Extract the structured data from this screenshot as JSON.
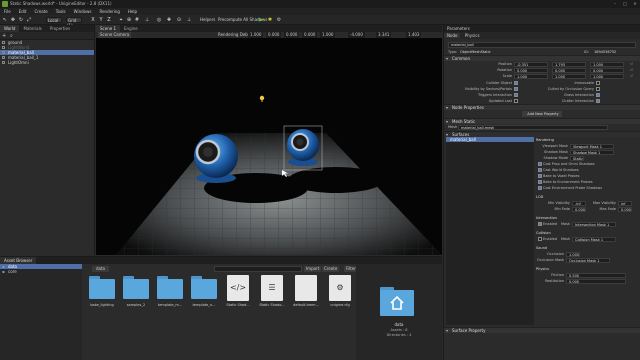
{
  "window": {
    "title": "Static Shadows.world* - UnigineEditor - 2.8 (DX11)",
    "minimize": "–",
    "maximize": "□",
    "close": "✕"
  },
  "menu": [
    "File",
    "Edit",
    "Create",
    "Tools",
    "Windows",
    "Rendering",
    "Help"
  ],
  "toolbar": {
    "space": "Local",
    "step": "Grid (1)",
    "helpers_label": "Helpers",
    "precompute_label": "Precompute All Shadows",
    "accent": "#5ac14a"
  },
  "world": {
    "tabs": [
      "World",
      "Materials",
      "Properties"
    ],
    "nodes": [
      {
        "name": "ground",
        "selected": false,
        "dim": false
      },
      {
        "name": "LightWorld",
        "selected": false,
        "dim": true
      },
      {
        "name": "material_ball",
        "selected": true,
        "dim": false
      },
      {
        "name": "material_ball_1",
        "selected": false,
        "dim": false
      },
      {
        "name": "LightOmni",
        "selected": false,
        "dim": false
      }
    ]
  },
  "scene": {
    "tabs": [
      "Scene 1",
      "Engine"
    ],
    "camera": "Scene Camera",
    "debug": "Rendering Debug",
    "values": [
      "1.000",
      "0.000",
      "0.000",
      "0.000",
      "1.000"
    ],
    "coords": [
      "-4.000",
      "3.341",
      "1.403"
    ]
  },
  "asset_browser": {
    "title": "Asset Browser",
    "tree": [
      "data",
      "core"
    ],
    "path": "data",
    "search_placeholder": "",
    "import_label": "Import",
    "create_label": "Create",
    "filter_label": "Filter",
    "items": [
      {
        "name": "bake_lighting",
        "kind": "folder"
      },
      {
        "name": "samples_2",
        "kind": "folder"
      },
      {
        "name": "template_m...",
        "kind": "folder"
      },
      {
        "name": "template_n...",
        "kind": "folder"
      },
      {
        "name": "Static Shad...",
        "kind": "file",
        "glyph": "</>"
      },
      {
        "name": "Static Shado...",
        "kind": "file",
        "glyph": "☰"
      },
      {
        "name": "default.bmm...",
        "kind": "file",
        "glyph": ""
      },
      {
        "name": "unigine.cfg",
        "kind": "file",
        "glyph": "⚙"
      }
    ],
    "preview": {
      "name": "data",
      "assets": "Assets : 8",
      "directories": "Directories : 4"
    }
  },
  "parameters": {
    "title": "Parameters",
    "tabs": [
      "Node",
      "Physics"
    ],
    "node_name": "material_ball",
    "type_label": "Type:",
    "type": "ObjectMeshStatic",
    "id_label": "ID:",
    "id": "1894536752",
    "common": {
      "title": "Common",
      "position_label": "Position",
      "position": [
        "-0.351",
        "1.793",
        "1.000"
      ],
      "rotation_label": "Rotation",
      "rotation": [
        "0.000",
        "0.000",
        "0.000"
      ],
      "scale_label": "Scale",
      "scale": [
        "1.000",
        "1.000",
        "1.000"
      ],
      "flags": [
        {
          "label": "Collider Object",
          "on": true
        },
        {
          "label": "Immovable",
          "on": false
        },
        {
          "label": "Visibility by Sectors/Portals",
          "on": true
        },
        {
          "label": "Culled by Occlusion Query",
          "on": false
        },
        {
          "label": "Triggers Interaction",
          "on": true
        },
        {
          "label": "Grass Interaction",
          "on": true
        },
        {
          "label": "Updated Last",
          "on": false
        },
        {
          "label": "Clutter Interaction",
          "on": true
        }
      ]
    },
    "node_props": {
      "title": "Node Properties",
      "add_label": "Add New Property"
    },
    "mesh_static": {
      "title": "Mesh Static",
      "mesh_label": "Mesh",
      "mesh": "material_ball.mesh",
      "surfaces_title": "Surfaces",
      "surface": "material_ball",
      "rendering_title": "Rendering",
      "viewport_mask_label": "Viewport Mask",
      "viewport_mask": "Viewport Mask 1",
      "shadow_mask_label": "Shadow Mask",
      "shadow_mask": "Shadow Mask 1",
      "shadow_mode_label": "Shadow Mode",
      "shadow_mode": "Static",
      "options": [
        {
          "label": "Cast Prop and Omni Shadows",
          "on": true
        },
        {
          "label": "Cast World Shadows",
          "on": true
        },
        {
          "label": "Bake to Voxel Probes",
          "on": true
        },
        {
          "label": "Bake to Environment Probes",
          "on": true
        },
        {
          "label": "Cast Environment Probe Shadows",
          "on": true
        }
      ],
      "lod_title": "LOD",
      "min_visibility_label": "Min Visibility",
      "min_visibility": "-inf",
      "max_visibility_label": "Max Visibility",
      "max_visibility": "inf",
      "min_fade_label": "Min Fade",
      "min_fade": "0.000",
      "max_fade_label": "Max Fade",
      "max_fade": "0.000",
      "intersection_title": "Intersection",
      "enabled_label": "Enabled",
      "mask_label": "Mask",
      "intersection_mask": "Intersection Mask 1",
      "collision_title": "Collision",
      "collision_mask": "Collision Mask 1",
      "sound_title": "Sound",
      "occlusion_label": "Occlusion",
      "occlusion": "1.000",
      "occlusion_mask_label": "Occlusion Mask",
      "occlusion_mask": "Occlusion Mask 1",
      "physics_title": "Physics",
      "friction_label": "Friction",
      "friction": "0.500",
      "restitution_label": "Restitution",
      "restitution": "0.000",
      "surface_property_title": "Surface Property"
    }
  }
}
